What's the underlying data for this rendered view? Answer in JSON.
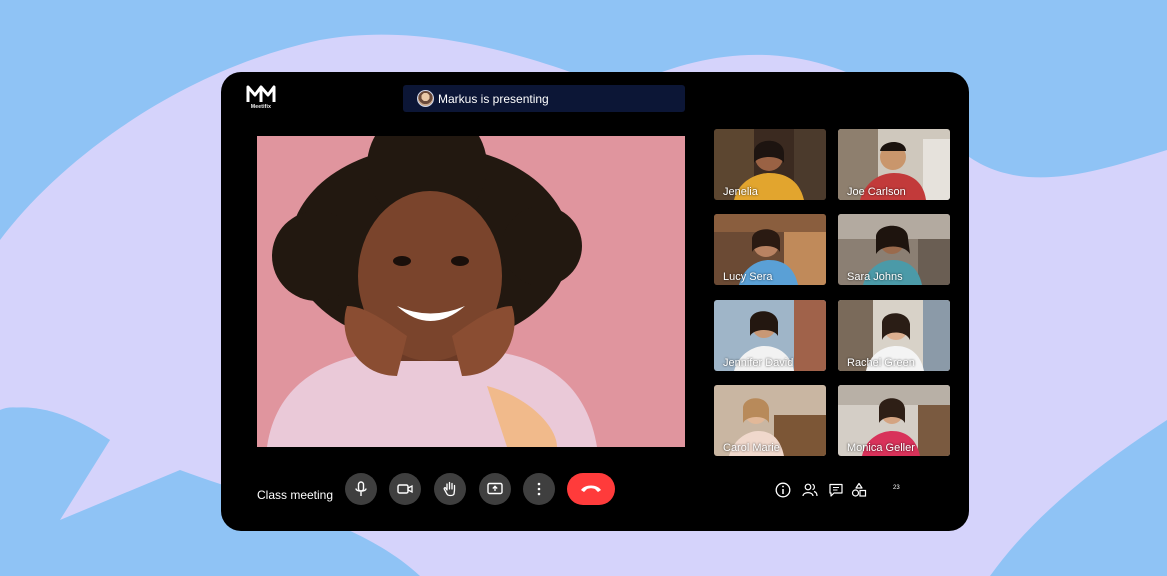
{
  "app": {
    "brand": "Meetifix"
  },
  "banner": {
    "presenting_text": "Markus is presenting"
  },
  "participants": [
    {
      "name": "Jenelia"
    },
    {
      "name": "Joe Carlson"
    },
    {
      "name": "Lucy Sera"
    },
    {
      "name": "Sara Johns"
    },
    {
      "name": "Jennifer David"
    },
    {
      "name": "Rachel Green"
    },
    {
      "name": "Carol Marie"
    },
    {
      "name": "Monica Geller"
    }
  ],
  "controls": {
    "meeting_title": "Class meeting",
    "buttons": [
      "microphone-icon",
      "video-camera-icon",
      "raise-hand-icon",
      "share-screen-icon",
      "more-options-icon",
      "end-call-icon"
    ]
  },
  "sidebar_tools": {
    "icons": [
      "info-icon",
      "people-icon",
      "chat-icon",
      "activities-icon"
    ],
    "participant_count": "23"
  },
  "colors": {
    "accent_red": "#ff3b3b",
    "panel": "#000000",
    "banner": "#0c1636",
    "control": "#3f3f3f"
  }
}
